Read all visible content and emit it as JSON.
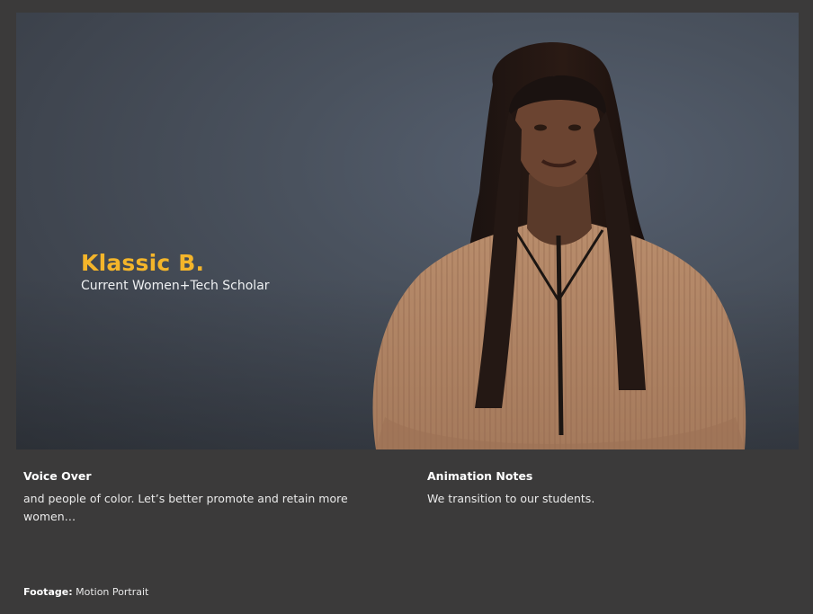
{
  "video": {
    "lower_third": {
      "name": "Klassic B.",
      "role": "Current Women+Tech Scholar"
    },
    "colors": {
      "name_accent": "#f4b52a",
      "background": "#4a525e",
      "panel": "#3b3a3a"
    }
  },
  "notes": {
    "voice_over": {
      "heading": "Voice Over",
      "text": " and people of color. Let’s better promote and retain more women…"
    },
    "animation_notes": {
      "heading": "Animation Notes",
      "text": "We transition to our students."
    },
    "footage": {
      "label": "Footage:",
      "value": "Motion Portrait"
    }
  }
}
